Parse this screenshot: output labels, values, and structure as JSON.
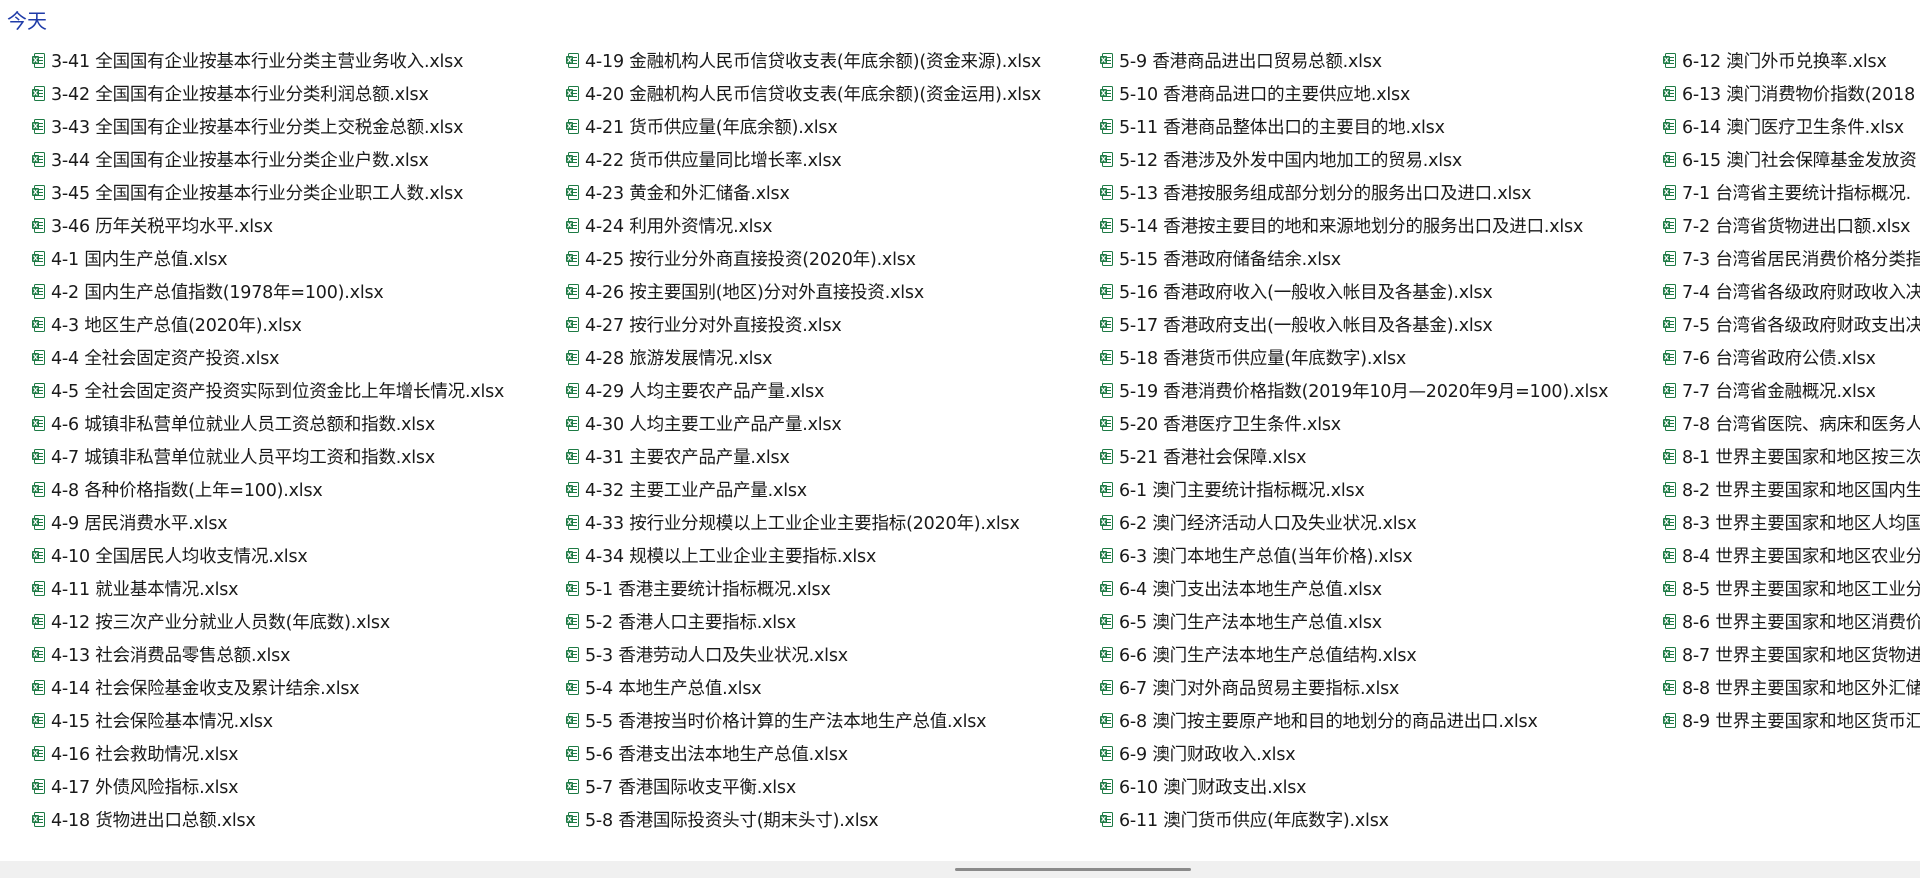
{
  "group_header": "今天",
  "icons": {
    "file": "xlsx-file-icon",
    "icon_color": "#1d7a44"
  },
  "columns": [
    [
      "3-41 全国国有企业按基本行业分类主营业务收入.xlsx",
      "3-42 全国国有企业按基本行业分类利润总额.xlsx",
      "3-43 全国国有企业按基本行业分类上交税金总额.xlsx",
      "3-44 全国国有企业按基本行业分类企业户数.xlsx",
      "3-45 全国国有企业按基本行业分类企业职工人数.xlsx",
      "3-46 历年关税平均水平.xlsx",
      "4-1 国内生产总值.xlsx",
      "4-2 国内生产总值指数(1978年=100).xlsx",
      "4-3 地区生产总值(2020年).xlsx",
      "4-4 全社会固定资产投资.xlsx",
      "4-5 全社会固定资产投资实际到位资金比上年增长情况.xlsx",
      "4-6 城镇非私营单位就业人员工资总额和指数.xlsx",
      "4-7 城镇非私营单位就业人员平均工资和指数.xlsx",
      "4-8 各种价格指数(上年=100).xlsx",
      "4-9 居民消费水平.xlsx",
      "4-10 全国居民人均收支情况.xlsx",
      "4-11 就业基本情况.xlsx",
      "4-12 按三次产业分就业人员数(年底数).xlsx",
      "4-13 社会消费品零售总额.xlsx",
      "4-14 社会保险基金收支及累计结余.xlsx",
      "4-15 社会保险基本情况.xlsx",
      "4-16 社会救助情况.xlsx",
      "4-17 外债风险指标.xlsx",
      "4-18 货物进出口总额.xlsx"
    ],
    [
      "4-19 金融机构人民币信贷收支表(年底余额)(资金来源).xlsx",
      "4-20 金融机构人民币信贷收支表(年底余额)(资金运用).xlsx",
      "4-21 货币供应量(年底余额).xlsx",
      "4-22 货币供应量同比增长率.xlsx",
      "4-23 黄金和外汇储备.xlsx",
      "4-24 利用外资情况.xlsx",
      "4-25 按行业分外商直接投资(2020年).xlsx",
      "4-26 按主要国别(地区)分对外直接投资.xlsx",
      "4-27 按行业分对外直接投资.xlsx",
      "4-28 旅游发展情况.xlsx",
      "4-29 人均主要农产品产量.xlsx",
      "4-30 人均主要工业产品产量.xlsx",
      "4-31 主要农产品产量.xlsx",
      "4-32 主要工业产品产量.xlsx",
      "4-33 按行业分规模以上工业企业主要指标(2020年).xlsx",
      "4-34 规模以上工业企业主要指标.xlsx",
      "5-1 香港主要统计指标概况.xlsx",
      "5-2 香港人口主要指标.xlsx",
      "5-3 香港劳动人口及失业状况.xlsx",
      "5-4 本地生产总值.xlsx",
      "5-5 香港按当时价格计算的生产法本地生产总值.xlsx",
      "5-6 香港支出法本地生产总值.xlsx",
      "5-7 香港国际收支平衡.xlsx",
      "5-8 香港国际投资头寸(期末头寸).xlsx"
    ],
    [
      "5-9 香港商品进出口贸易总额.xlsx",
      "5-10 香港商品进口的主要供应地.xlsx",
      "5-11 香港商品整体出口的主要目的地.xlsx",
      "5-12 香港涉及外发中国内地加工的贸易.xlsx",
      "5-13 香港按服务组成部分划分的服务出口及进口.xlsx",
      "5-14 香港按主要目的地和来源地划分的服务出口及进口.xlsx",
      "5-15 香港政府储备结余.xlsx",
      "5-16 香港政府收入(一般收入帐目及各基金).xlsx",
      "5-17 香港政府支出(一般收入帐目及各基金).xlsx",
      "5-18 香港货币供应量(年底数字).xlsx",
      "5-19 香港消费价格指数(2019年10月—2020年9月=100).xlsx",
      "5-20 香港医疗卫生条件.xlsx",
      "5-21 香港社会保障.xlsx",
      "6-1 澳门主要统计指标概况.xlsx",
      "6-2 澳门经济活动人口及失业状况.xlsx",
      "6-3 澳门本地生产总值(当年价格).xlsx",
      "6-4 澳门支出法本地生产总值.xlsx",
      "6-5 澳门生产法本地生产总值.xlsx",
      "6-6 澳门生产法本地生产总值结构.xlsx",
      "6-7 澳门对外商品贸易主要指标.xlsx",
      "6-8 澳门按主要原产地和目的地划分的商品进出口.xlsx",
      "6-9 澳门财政收入.xlsx",
      "6-10 澳门财政支出.xlsx",
      "6-11 澳门货币供应(年底数字).xlsx"
    ],
    [
      "6-12 澳门外币兑换率.xlsx",
      "6-13 澳门消费物价指数(2018",
      "6-14 澳门医疗卫生条件.xlsx",
      "6-15 澳门社会保障基金发放资",
      "7-1 台湾省主要统计指标概况.",
      "7-2 台湾省货物进出口额.xlsx",
      "7-3 台湾省居民消费价格分类指",
      "7-4 台湾省各级政府财政收入决",
      "7-5 台湾省各级政府财政支出决",
      "7-6 台湾省政府公债.xlsx",
      "7-7 台湾省金融概况.xlsx",
      "7-8 台湾省医院、病床和医务人",
      "8-1 世界主要国家和地区按三次",
      "8-2 世界主要国家和地区国内生",
      "8-3 世界主要国家和地区人均国",
      "8-4 世界主要国家和地区农业分",
      "8-5 世界主要国家和地区工业分",
      "8-6 世界主要国家和地区消费价",
      "8-7 世界主要国家和地区货物进",
      "8-8 世界主要国家和地区外汇储",
      "8-9 世界主要国家和地区货币汇"
    ]
  ]
}
